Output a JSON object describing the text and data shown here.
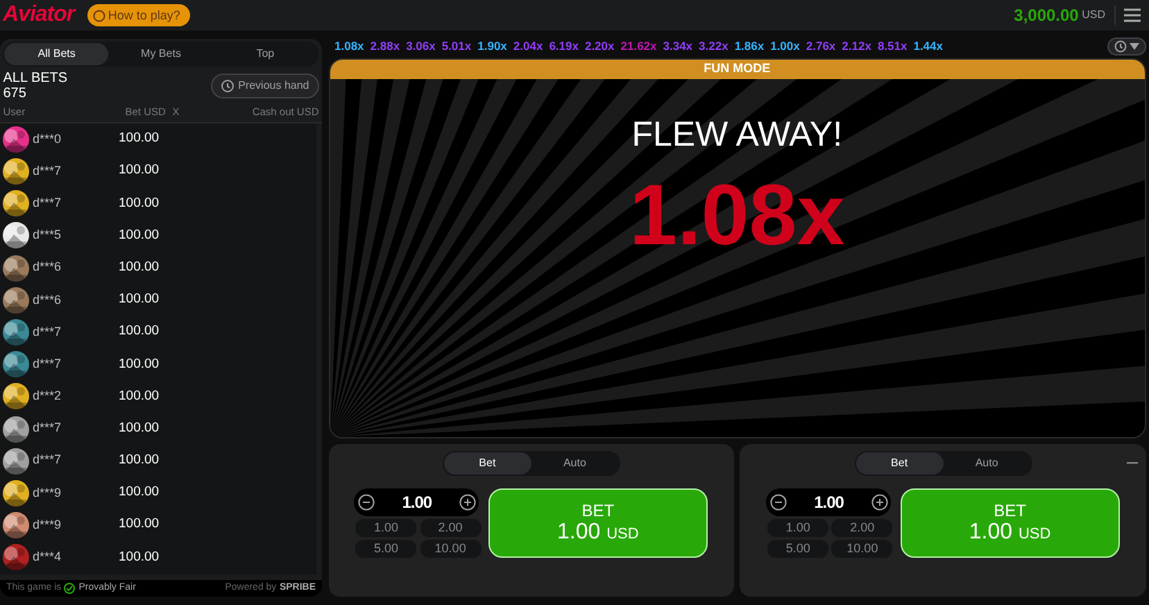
{
  "header": {
    "logo": "Aviator",
    "how_to_play": "How to play?",
    "balance": "3,000.00",
    "currency": "USD"
  },
  "bets_panel": {
    "tabs": [
      {
        "label": "All Bets",
        "selected": true
      },
      {
        "label": "My Bets",
        "selected": false
      },
      {
        "label": "Top",
        "selected": false
      }
    ],
    "title": "ALL BETS",
    "count": "675",
    "previous_hand": "Previous hand",
    "columns": [
      "User",
      "Bet USD",
      "X",
      "Cash out USD"
    ],
    "rows": [
      {
        "user": "d***0",
        "bet": "100.00",
        "color": "#e8308a"
      },
      {
        "user": "d***7",
        "bet": "100.00",
        "color": "#e0b020"
      },
      {
        "user": "d***7",
        "bet": "100.00",
        "color": "#e0b020"
      },
      {
        "user": "d***5",
        "bet": "100.00",
        "color": "#e8e8e8"
      },
      {
        "user": "d***6",
        "bet": "100.00",
        "color": "#9a7a5a"
      },
      {
        "user": "d***6",
        "bet": "100.00",
        "color": "#9a7a5a"
      },
      {
        "user": "d***7",
        "bet": "100.00",
        "color": "#3a8a96"
      },
      {
        "user": "d***7",
        "bet": "100.00",
        "color": "#3a8a96"
      },
      {
        "user": "d***2",
        "bet": "100.00",
        "color": "#e0b020"
      },
      {
        "user": "d***7",
        "bet": "100.00",
        "color": "#a0a0a0"
      },
      {
        "user": "d***7",
        "bet": "100.00",
        "color": "#a0a0a0"
      },
      {
        "user": "d***9",
        "bet": "100.00",
        "color": "#e0b020"
      },
      {
        "user": "d***9",
        "bet": "100.00",
        "color": "#d08a70"
      },
      {
        "user": "d***4",
        "bet": "100.00",
        "color": "#b02020"
      }
    ],
    "footer": {
      "provably_prefix": "This game is",
      "provably": "Provably Fair",
      "powered_prefix": "Powered by",
      "powered": "SPRIBE"
    }
  },
  "history": [
    {
      "value": "1.08x",
      "color": "#34b4ff"
    },
    {
      "value": "2.88x",
      "color": "#913ef8"
    },
    {
      "value": "3.06x",
      "color": "#913ef8"
    },
    {
      "value": "5.01x",
      "color": "#913ef8"
    },
    {
      "value": "1.90x",
      "color": "#34b4ff"
    },
    {
      "value": "2.04x",
      "color": "#913ef8"
    },
    {
      "value": "6.19x",
      "color": "#913ef8"
    },
    {
      "value": "2.20x",
      "color": "#913ef8"
    },
    {
      "value": "21.62x",
      "color": "#c017b4"
    },
    {
      "value": "3.34x",
      "color": "#913ef8"
    },
    {
      "value": "3.22x",
      "color": "#913ef8"
    },
    {
      "value": "1.86x",
      "color": "#34b4ff"
    },
    {
      "value": "1.00x",
      "color": "#34b4ff"
    },
    {
      "value": "2.76x",
      "color": "#913ef8"
    },
    {
      "value": "2.12x",
      "color": "#913ef8"
    },
    {
      "value": "8.51x",
      "color": "#913ef8"
    },
    {
      "value": "1.44x",
      "color": "#34b4ff"
    }
  ],
  "game": {
    "mode": "FUN MODE",
    "message": "FLEW AWAY!",
    "multiplier": "1.08x"
  },
  "bet_controls": [
    {
      "tabs": [
        {
          "label": "Bet",
          "selected": true
        },
        {
          "label": "Auto",
          "selected": false
        }
      ],
      "minimize": false,
      "amount": "1.00",
      "quick": [
        "1.00",
        "2.00",
        "5.00",
        "10.00"
      ],
      "button_label": "BET",
      "button_amount": "1.00",
      "button_currency": "USD"
    },
    {
      "tabs": [
        {
          "label": "Bet",
          "selected": true
        },
        {
          "label": "Auto",
          "selected": false
        }
      ],
      "minimize": true,
      "amount": "1.00",
      "quick": [
        "1.00",
        "2.00",
        "5.00",
        "10.00"
      ],
      "button_label": "BET",
      "button_amount": "1.00",
      "button_currency": "USD"
    }
  ]
}
